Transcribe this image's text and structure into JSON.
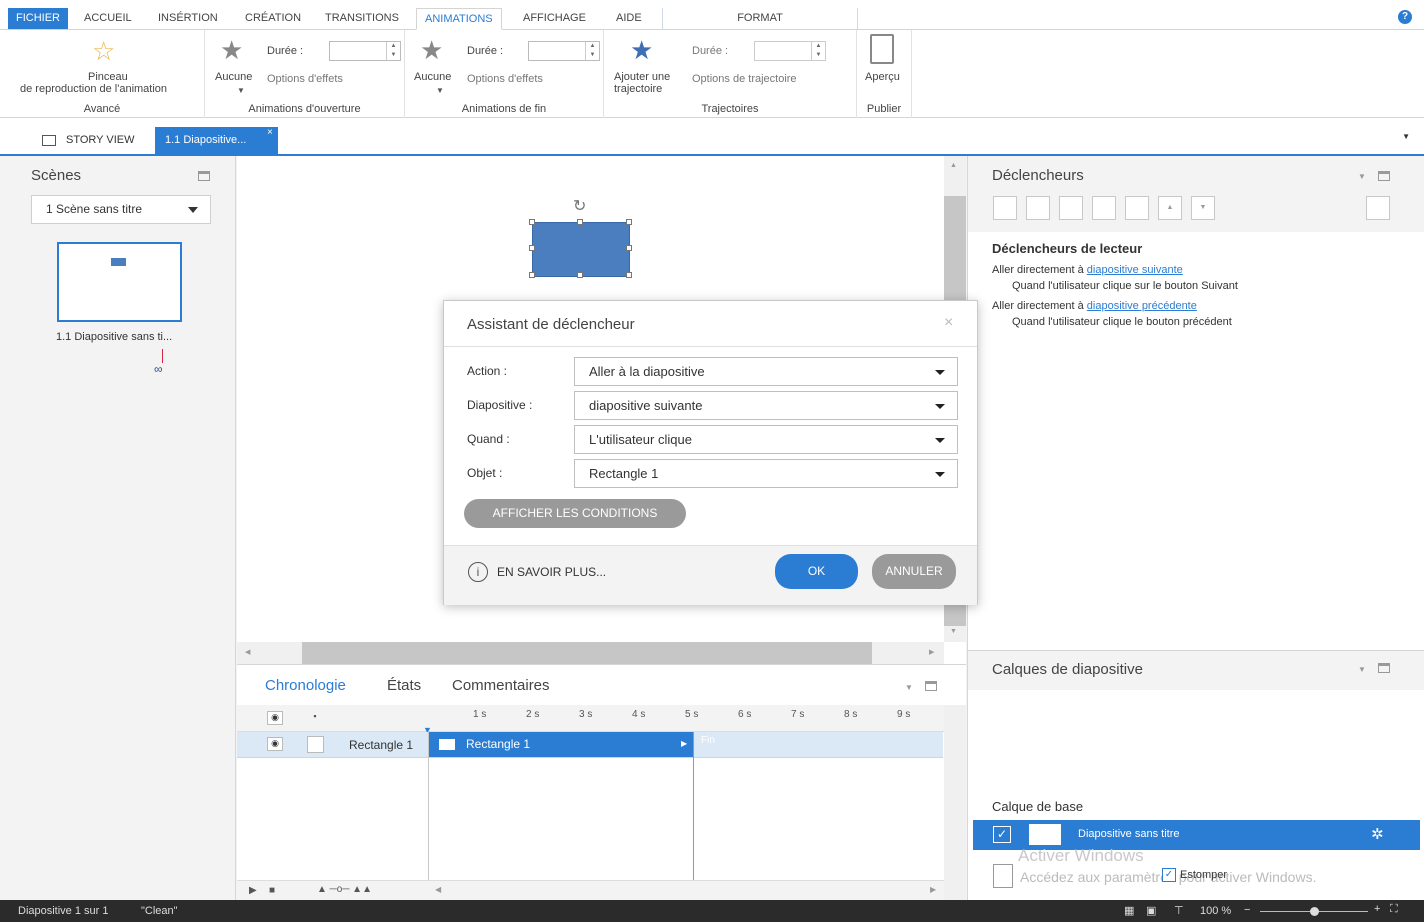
{
  "ribbon_tabs": [
    "FICHIER",
    "ACCUEIL",
    "INSÉRTION",
    "CRÉATION",
    "TRANSITIONS",
    "ANIMATIONS",
    "AFFICHAGE",
    "AIDE"
  ],
  "context_tab": "FORMAT",
  "ribbon": {
    "advanced": {
      "button_line1": "Pinceau",
      "button_line2": "de reproduction de l'animation",
      "group": "Avancé"
    },
    "entrance": {
      "none_label": "Aucune",
      "duration_label": "Durée :",
      "effect_options": "Options d'effets",
      "group": "Animations d'ouverture"
    },
    "exit": {
      "none_label": "Aucune",
      "duration_label": "Durée :",
      "effect_options": "Options d'effets",
      "group": "Animations de fin"
    },
    "paths": {
      "add_line1": "Ajouter une",
      "add_line2": "trajectoire",
      "duration_label": "Durée :",
      "path_options": "Options de trajectoire",
      "group": "Trajectoires"
    },
    "publish": {
      "preview": "Aperçu",
      "group": "Publier"
    }
  },
  "doc_tabs": {
    "story_view": "STORY VIEW",
    "slide": "1.1 Diapositive..."
  },
  "scenes": {
    "title": "Scènes",
    "selected_scene": "1 Scène sans titre",
    "thumb_label": "1.1 Diapositive sans ti..."
  },
  "timeline": {
    "tabs": [
      "Chronologie",
      "États",
      "Commentaires"
    ],
    "ticks": [
      "1 s",
      "2 s",
      "3 s",
      "4 s",
      "5 s",
      "6 s",
      "7 s",
      "8 s",
      "9 s"
    ],
    "row_name": "Rectangle 1",
    "bar_label": "Rectangle 1",
    "end_label": "Fin"
  },
  "triggers": {
    "title": "Déclencheurs",
    "section": "Déclencheurs de lecteur",
    "items": [
      {
        "prefix": "Aller directement à",
        "link": "diapositive suivante",
        "condition": "Quand l'utilisateur clique sur le bouton Suivant"
      },
      {
        "prefix": "Aller directement à",
        "link": "diapositive précédente",
        "condition": "Quand l'utilisateur clique le bouton précédent"
      }
    ]
  },
  "layers": {
    "title": "Calques de diapositive",
    "base_title": "Calque de base",
    "base_name": "Diapositive sans titre",
    "dim_label": "Estomper",
    "watermark_title": "Activer Windows",
    "watermark_text": "Accédez aux paramètres pour activer Windows."
  },
  "dialog": {
    "title": "Assistant de déclencheur",
    "fields": [
      {
        "label": "Action :",
        "value": "Aller à la diapositive"
      },
      {
        "label": "Diapositive :",
        "value": "diapositive suivante"
      },
      {
        "label": "Quand :",
        "value": "L'utilisateur clique"
      },
      {
        "label": "Objet :",
        "value": "Rectangle 1"
      }
    ],
    "conditions_button": "AFFICHER LES CONDITIONS",
    "learn_more": "EN SAVOIR PLUS...",
    "ok": "OK",
    "cancel": "ANNULER"
  },
  "status": {
    "slide_info": "Diapositive 1 sur 1",
    "theme": "\"Clean\"",
    "zoom": "100 %"
  },
  "colors": {
    "accent": "#2b7cd3",
    "shape": "#4a7ebf",
    "button_gray": "#9a9a9a"
  }
}
